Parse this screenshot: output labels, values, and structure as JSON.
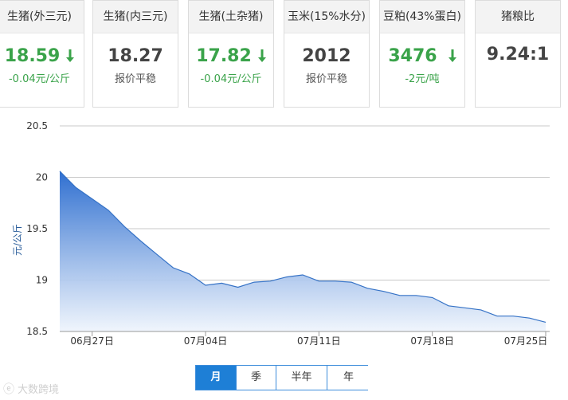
{
  "cards": [
    {
      "title": "生猪(外三元)",
      "value": "18.59",
      "sub": "-0.04元/公斤",
      "trend": "down"
    },
    {
      "title": "生猪(内三元)",
      "value": "18.27",
      "sub": "报价平稳",
      "trend": "flat"
    },
    {
      "title": "生猪(土杂猪)",
      "value": "17.82",
      "sub": "-0.04元/公斤",
      "trend": "down"
    },
    {
      "title": "玉米(15%水分)",
      "value": "2012",
      "sub": "报价平稳",
      "trend": "flat"
    },
    {
      "title": "豆粕(43%蛋白)",
      "value": "3476",
      "sub": "-2元/吨",
      "trend": "down"
    },
    {
      "title": "猪粮比",
      "value": "9.24:1",
      "sub": "",
      "trend": "flat"
    }
  ],
  "colors": {
    "down": "#3aa34a",
    "line": "#3572c6",
    "fill_top": "#2f6fd0",
    "fill_bottom": "#eef4fc",
    "tab_active": "#1e7fd6"
  },
  "chart_data": {
    "type": "area",
    "ylabel": "元/公斤",
    "ylim": [
      18.5,
      20.5
    ],
    "yticks": [
      "20.5",
      "20",
      "19.5",
      "19",
      "18.5"
    ],
    "xtick_labels": [
      "06月27日",
      "07月04日",
      "07月11日",
      "07月18日",
      "07月25日"
    ],
    "x": [
      "06/25",
      "06/26",
      "06/27",
      "06/28",
      "06/29",
      "06/30",
      "07/01",
      "07/02",
      "07/03",
      "07/04",
      "07/05",
      "07/06",
      "07/07",
      "07/08",
      "07/09",
      "07/10",
      "07/11",
      "07/12",
      "07/13",
      "07/14",
      "07/15",
      "07/16",
      "07/17",
      "07/18",
      "07/19",
      "07/20",
      "07/21",
      "07/22",
      "07/23",
      "07/24",
      "07/25"
    ],
    "values": [
      20.06,
      19.9,
      19.79,
      19.68,
      19.52,
      19.38,
      19.25,
      19.12,
      19.06,
      18.95,
      18.97,
      18.93,
      18.98,
      18.99,
      19.03,
      19.05,
      18.99,
      18.99,
      18.98,
      18.92,
      18.89,
      18.85,
      18.85,
      18.83,
      18.75,
      18.73,
      18.71,
      18.65,
      18.65,
      18.63,
      18.59
    ],
    "grid": true
  },
  "tabs": [
    {
      "label": "月",
      "active": true
    },
    {
      "label": "季",
      "active": false
    },
    {
      "label": "半年",
      "active": false
    },
    {
      "label": "年",
      "active": false
    }
  ],
  "watermark": "大数跨境"
}
